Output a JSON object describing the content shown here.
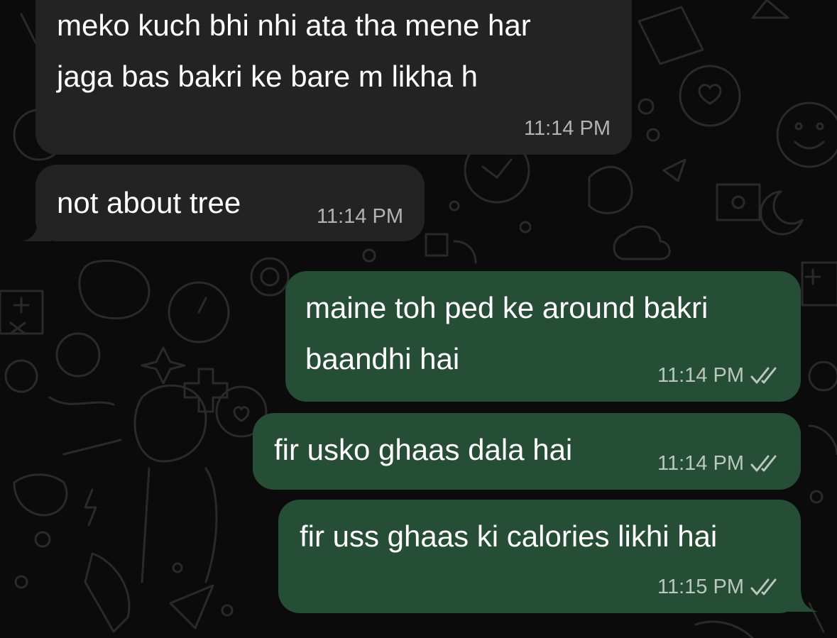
{
  "messages": [
    {
      "direction": "incoming",
      "lines": [
        "meko kuch bhi nhi ata tha mene har",
        "jaga bas bakri ke bare m likha h"
      ],
      "time": "11:14 PM"
    },
    {
      "direction": "incoming",
      "lines": [
        "not about tree"
      ],
      "time": "11:14 PM"
    },
    {
      "direction": "outgoing",
      "lines": [
        "maine toh ped ke around bakri",
        "baandhi hai"
      ],
      "time": "11:14 PM",
      "status_icon": "double-check-icon"
    },
    {
      "direction": "outgoing",
      "lines": [
        "fir usko ghaas dala hai"
      ],
      "time": "11:14 PM",
      "status_icon": "double-check-icon"
    },
    {
      "direction": "outgoing",
      "lines": [
        "fir uss ghaas ki calories likhi hai"
      ],
      "time": "11:15 PM",
      "status_icon": "double-check-icon"
    }
  ],
  "colors": {
    "background": "#0b0b0b",
    "incoming_bubble": "#232323",
    "outgoing_bubble": "#264d36",
    "text": "#ffffff",
    "timestamp": "#b3b3b3"
  }
}
